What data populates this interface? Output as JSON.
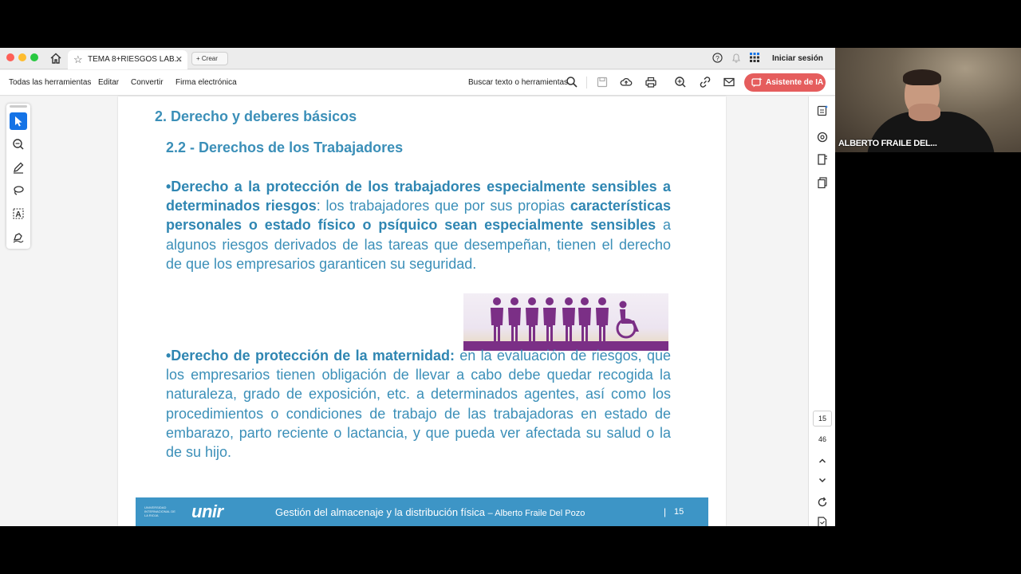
{
  "window": {
    "tab_title": "TEMA 8+RIESGOS LAB...",
    "new_button": "Crear",
    "signin": "Iniciar sesión"
  },
  "toolbar": {
    "all_tools": "Todas las herramientas",
    "edit": "Editar",
    "convert": "Convertir",
    "esign": "Firma electrónica",
    "search": "Buscar texto o herramientas",
    "ai_assistant": "Asistente de IA"
  },
  "document": {
    "heading": "2. Derecho y deberes básicos",
    "subheading": "2.2 - Derechos de los Trabajadores",
    "p1": {
      "bold1": "•Derecho a la protección de los trabajadores especialmente sensibles a determinados riesgos",
      "text1": ": los trabajadores que por sus propias ",
      "bold2": "características personales o estado físico o psíquico sean especialmente sensibles",
      "text2": " a algunos riesgos derivados de las tareas que desempeñan, tienen el derecho de que los empresarios garanticen su seguridad."
    },
    "p2": {
      "bold1": "•Derecho de protección de la maternidad:",
      "text1": " en la evaluación de riesgos, que los empresarios tienen obligación de llevar a cabo debe quedar recogida la naturaleza, grado de exposición, etc. a determinados agentes, así como los procedimientos o condiciones de trabajo de las trabajadoras en estado de embarazo, parto reciente o lactancia, y que pueda ver afectada su salud o la de su hijo."
    },
    "footer": {
      "logo_small": "UNIVERSIDAD INTERNACIONAL DE LA RIOJA",
      "logo": "unir",
      "text": "Gestión del almacenaje y la distribución física",
      "author": "– Alberto Fraile Del Pozo",
      "pipe": "|",
      "page": "15"
    }
  },
  "navigation": {
    "current_page": "15",
    "total_pages": "46"
  },
  "webcam": {
    "participant_name": "ALBERTO FRAILE DEL..."
  },
  "colors": {
    "doc_text": "#3b8fb8",
    "footer_bg": "#3d95c6",
    "ai_button": "#e55d5d",
    "selected_tool": "#1473e6",
    "figure_purple": "#7b2f86"
  }
}
